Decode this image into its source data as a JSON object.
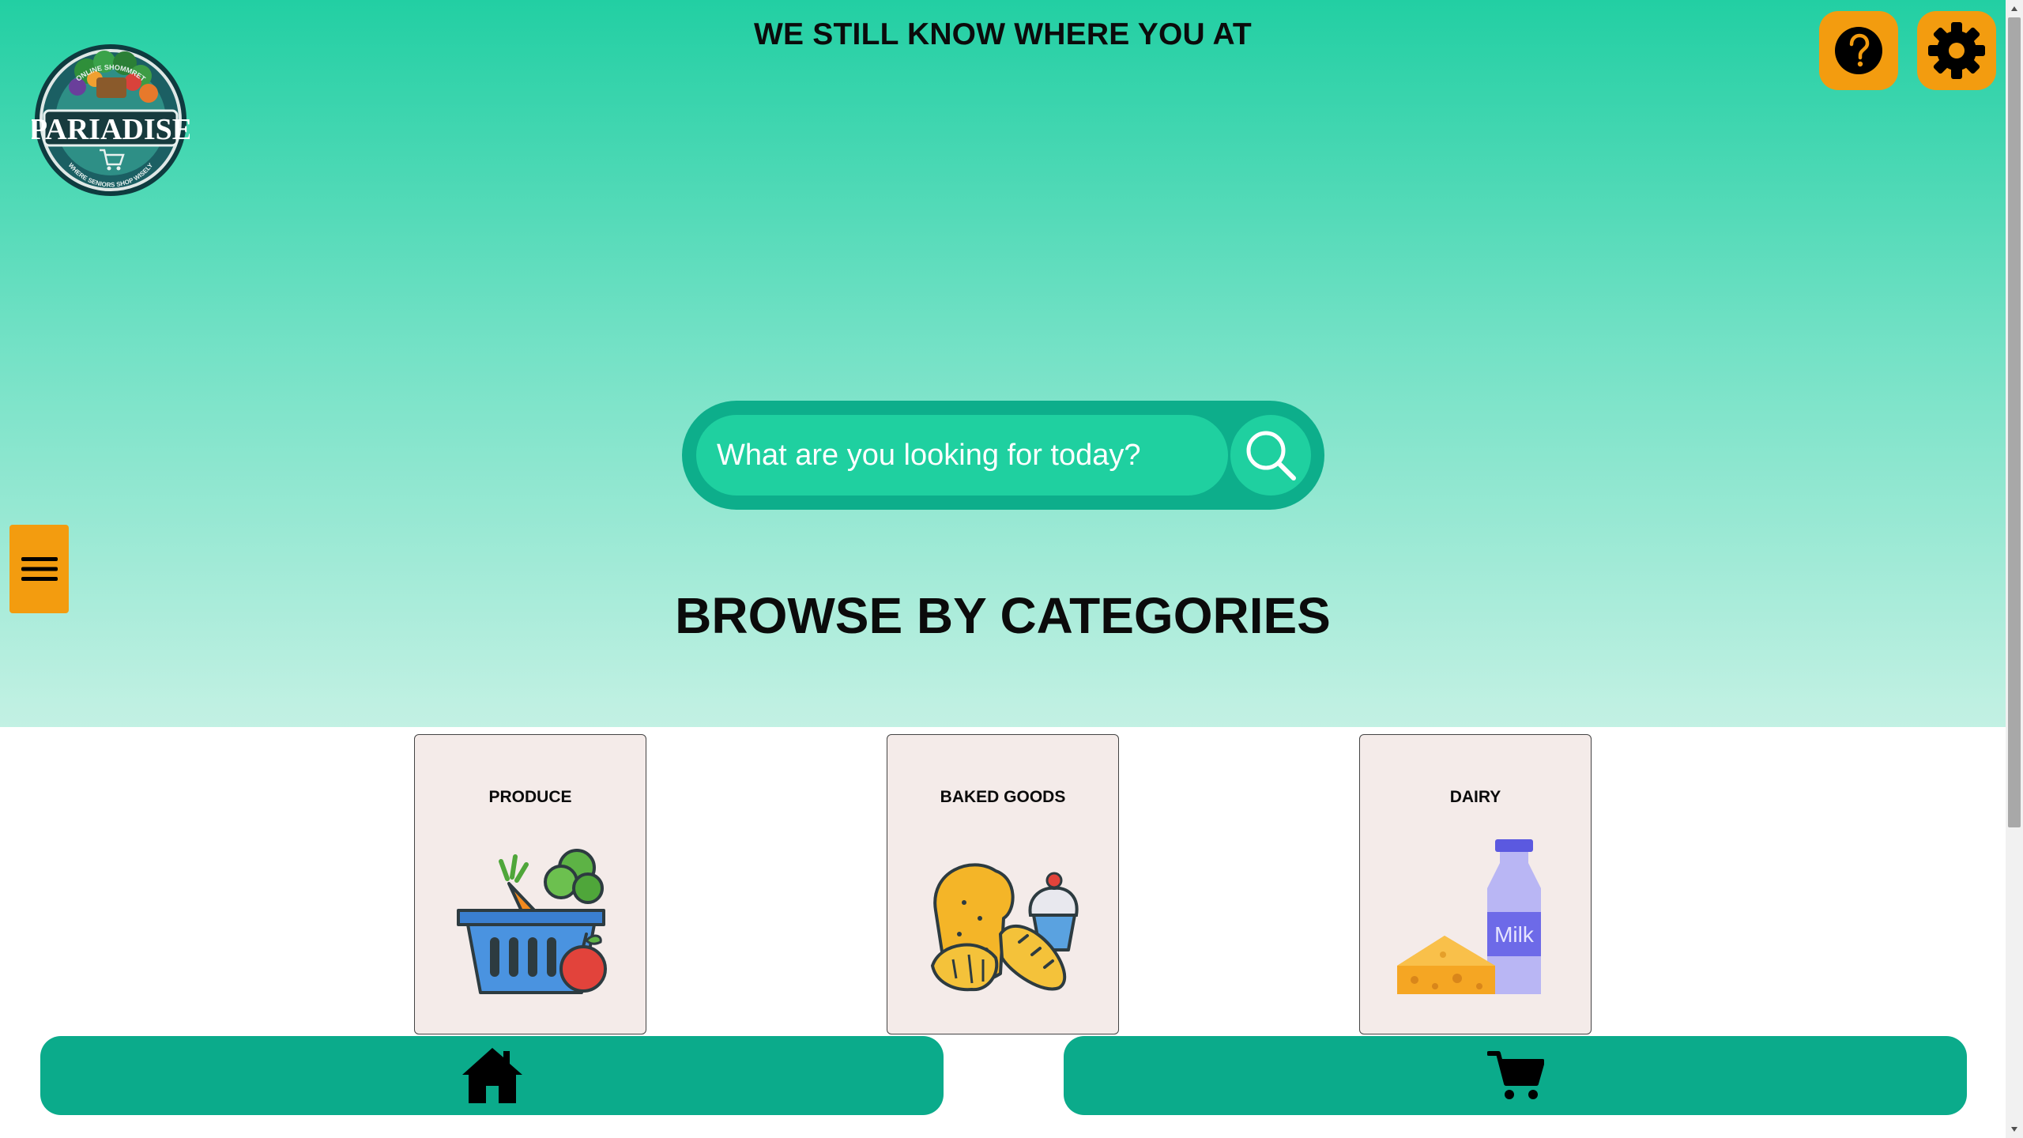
{
  "header": {
    "banner": "WE STILL KNOW WHERE YOU AT",
    "logo": {
      "brand": "PARIADISE",
      "tagline_top": "ONLINE SHOMMRET",
      "tagline_bottom": "WHERE SENIORS SHOP WISELY",
      "icon": "grocery-basket-logo"
    },
    "help_icon": "question-mark-icon",
    "settings_icon": "gear-icon"
  },
  "sidebar": {
    "menu_icon": "hamburger-menu-icon"
  },
  "search": {
    "placeholder": "What are you looking for today?",
    "value": "",
    "icon": "search-icon"
  },
  "categories": {
    "title": "BROWSE BY CATEGORIES",
    "items": [
      {
        "label": "PRODUCE",
        "icon": "produce-basket-icon"
      },
      {
        "label": "BAKED GOODS",
        "icon": "baked-goods-icon"
      },
      {
        "label": "DAIRY",
        "icon": "dairy-icon",
        "image_text": "Milk"
      }
    ]
  },
  "bottom_nav": {
    "home_icon": "home-icon",
    "cart_icon": "cart-icon"
  },
  "colors": {
    "accent_orange": "#f39c0f",
    "teal_dark": "#0bab8b",
    "teal_light": "#1fd0a0",
    "gradient_top": "#22cfa3",
    "card_bg": "#f4ebe9"
  }
}
